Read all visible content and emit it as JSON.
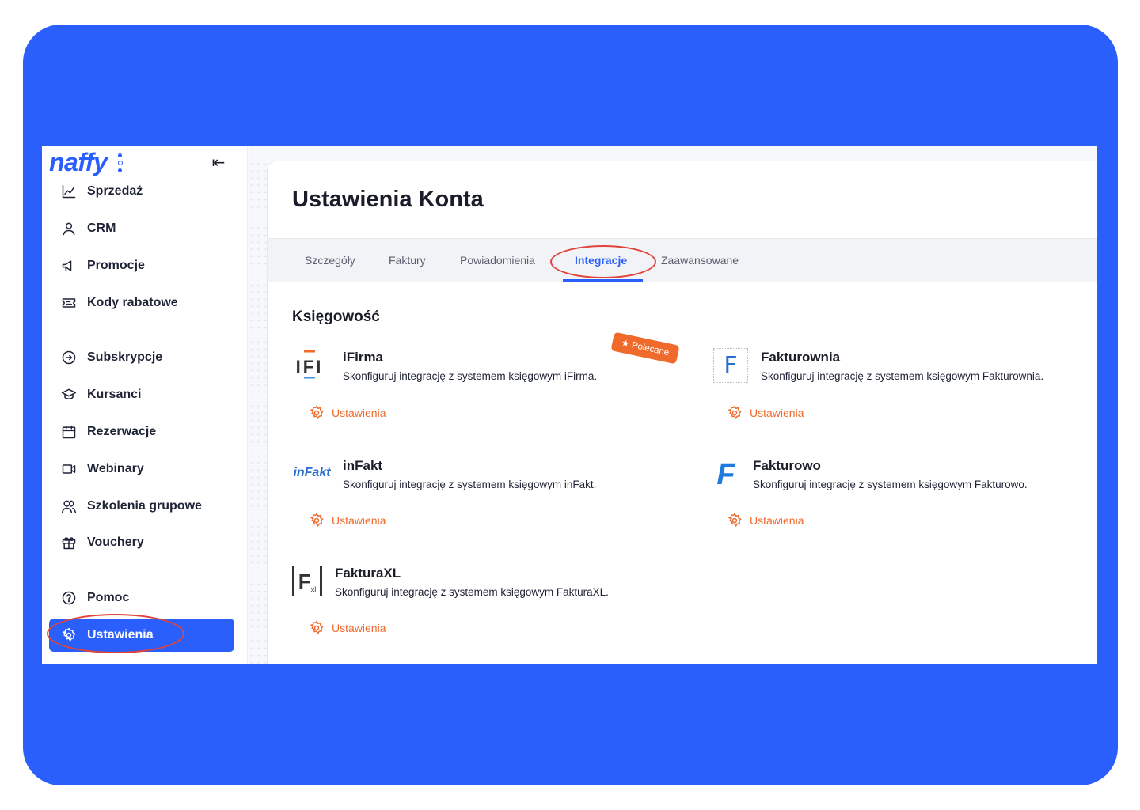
{
  "colors": {
    "brand": "#2a5ffc",
    "accent": "#f06a2c",
    "highlight": "#e0443a"
  },
  "sidebar": {
    "logo": "naffy",
    "collapse_icon": "collapse-left-icon",
    "items": [
      {
        "label": "Sprzedaż",
        "icon": "chart-line-icon"
      },
      {
        "label": "CRM",
        "icon": "user-icon"
      },
      {
        "label": "Promocje",
        "icon": "megaphone-icon"
      },
      {
        "label": "Kody rabatowe",
        "icon": "ticket-icon"
      },
      {
        "label": "Subskrypcje",
        "icon": "refresh-icon"
      },
      {
        "label": "Kursanci",
        "icon": "graduation-cap-icon"
      },
      {
        "label": "Rezerwacje",
        "icon": "calendar-icon"
      },
      {
        "label": "Webinary",
        "icon": "video-icon"
      },
      {
        "label": "Szkolenia grupowe",
        "icon": "users-icon"
      },
      {
        "label": "Vouchery",
        "icon": "gift-icon"
      },
      {
        "label": "Pomoc",
        "icon": "help-icon"
      },
      {
        "label": "Ustawienia",
        "icon": "gear-icon",
        "active": true
      }
    ]
  },
  "main": {
    "title": "Ustawienia Konta",
    "tabs": [
      {
        "label": "Szczegóły"
      },
      {
        "label": "Faktury"
      },
      {
        "label": "Powiadomienia"
      },
      {
        "label": "Integracje",
        "active": true
      },
      {
        "label": "Zaawansowane"
      }
    ],
    "section_title": "Księgowość",
    "integrations": [
      {
        "name": "iFirma",
        "logo_text": "IFI",
        "description": "Skonfiguruj integrację z systemem księgowym iFirma.",
        "settings_label": "Ustawienia",
        "badge": "★ Polecane"
      },
      {
        "name": "Fakturownia",
        "logo_text": "F",
        "description": "Skonfiguruj integrację z systemem księgowym Fakturownia.",
        "settings_label": "Ustawienia"
      },
      {
        "name": "inFakt",
        "logo_text": "inFakt",
        "description": "Skonfiguruj integrację z systemem księgowym inFakt.",
        "settings_label": "Ustawienia"
      },
      {
        "name": "Fakturowo",
        "logo_text": "F",
        "description": "Skonfiguruj integrację z systemem księgowym Fakturowo.",
        "settings_label": "Ustawienia"
      },
      {
        "name": "FakturaXL",
        "logo_text": "F",
        "logo_subtext": "xl",
        "description": "Skonfiguruj integrację z systemem księgowym FakturaXL.",
        "settings_label": "Ustawienia"
      }
    ]
  }
}
